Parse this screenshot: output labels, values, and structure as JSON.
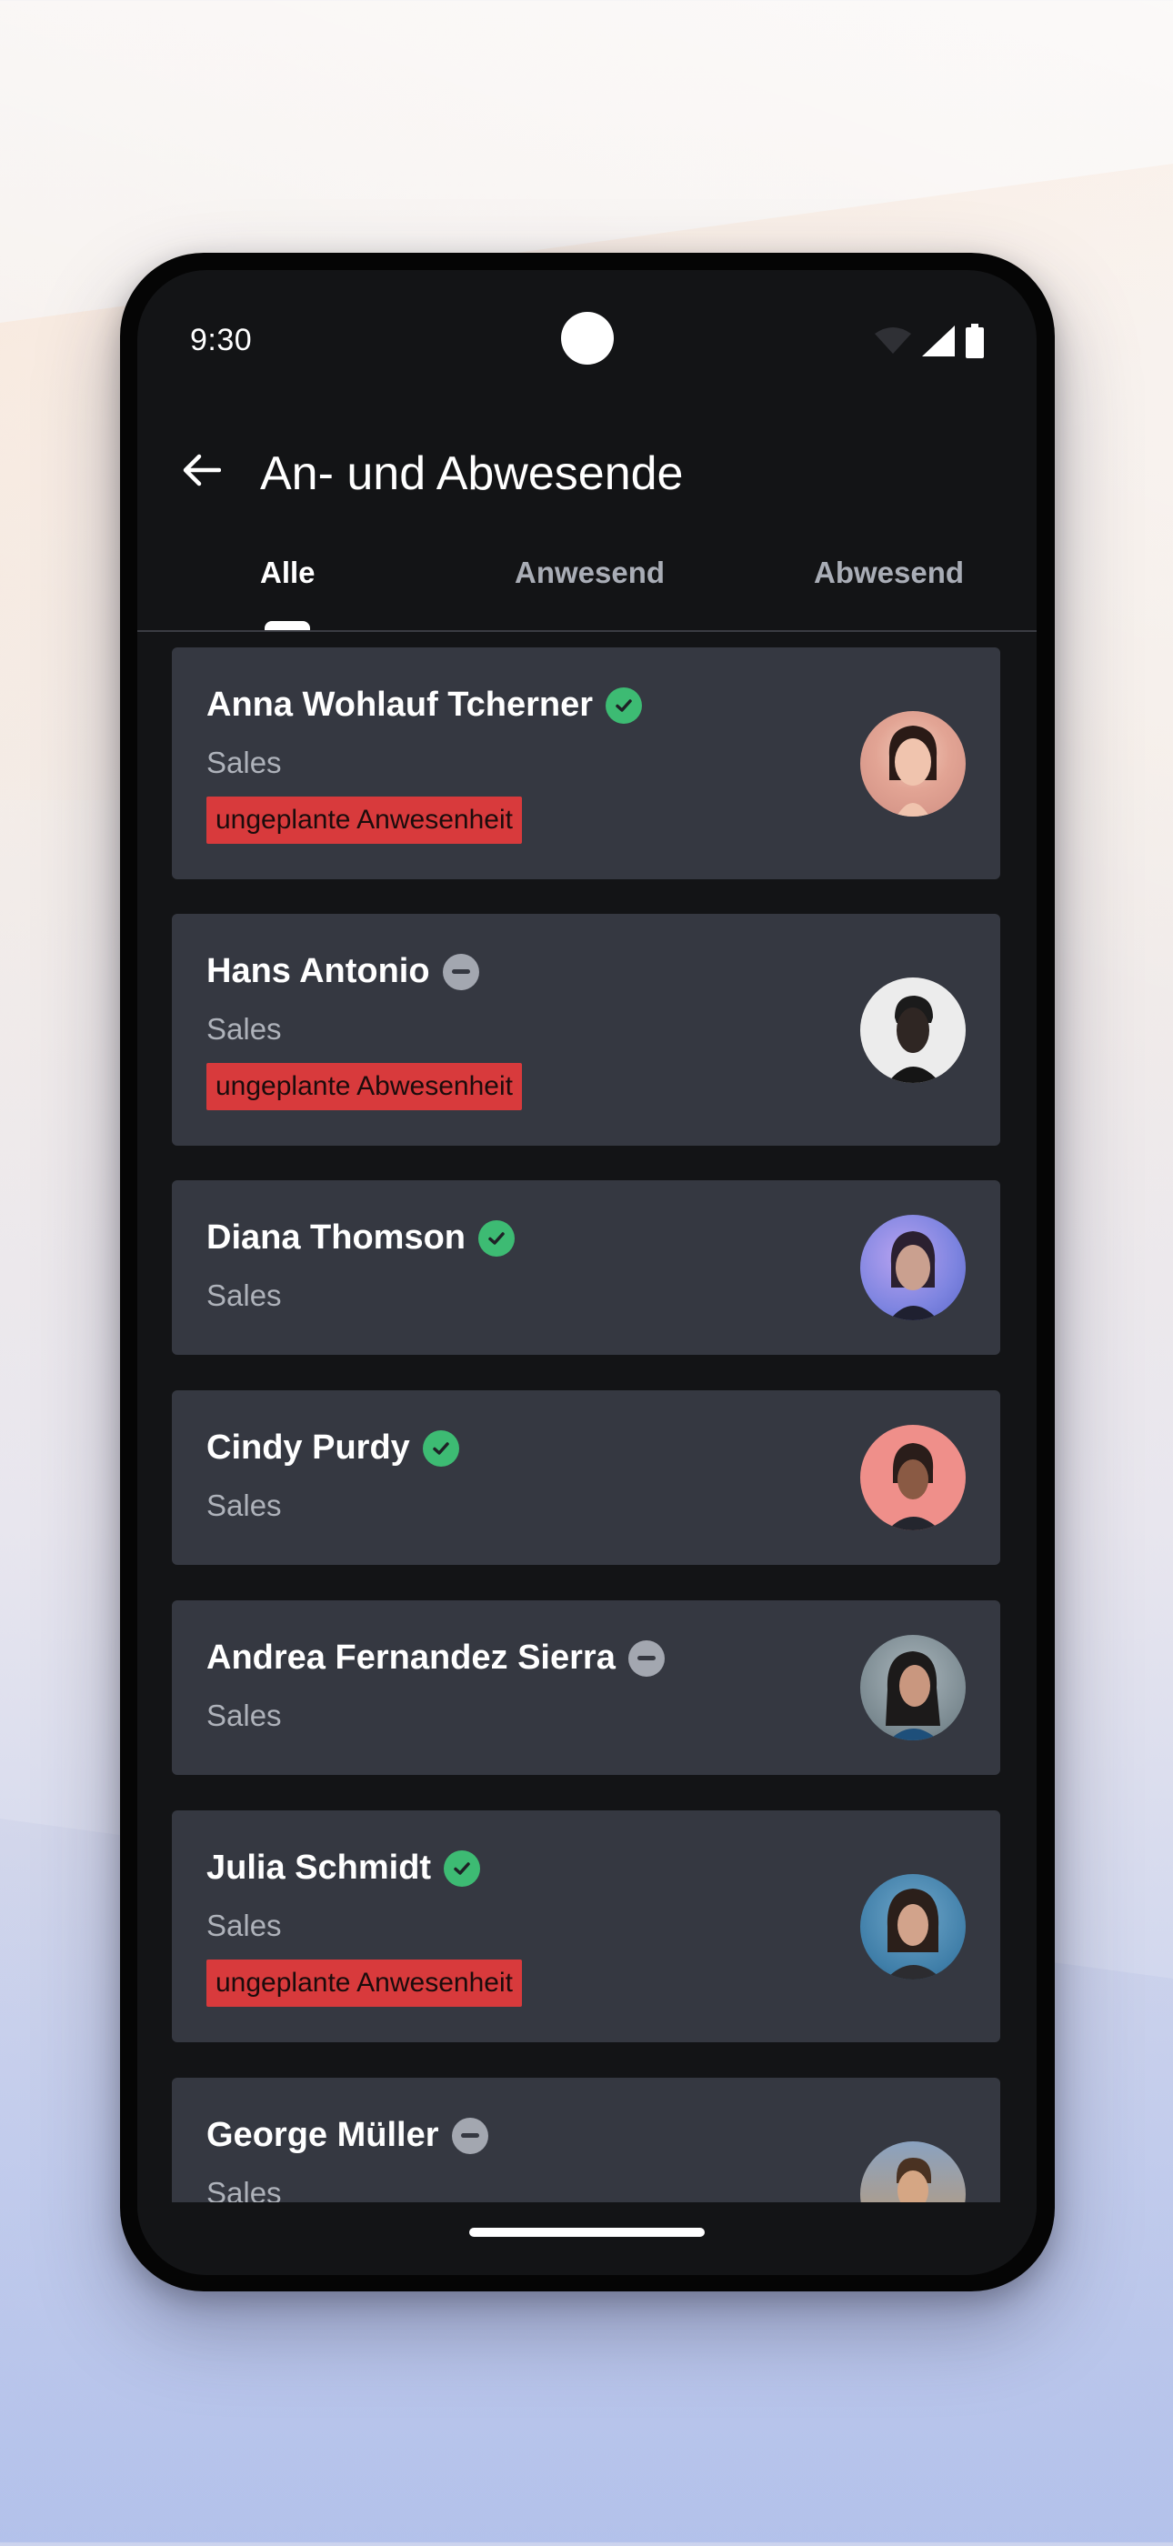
{
  "status_bar": {
    "time": "9:30"
  },
  "app_bar": {
    "title": "An- und Abwesende"
  },
  "tabs": [
    {
      "label": "Alle",
      "active": true
    },
    {
      "label": "Anwesend",
      "active": false
    },
    {
      "label": "Abwesend",
      "active": false
    }
  ],
  "employees": [
    {
      "name": "Anna Wohlauf Tcherner",
      "status": "present",
      "department": "Sales",
      "badge": "ungeplante Anwesenheit",
      "avatar_color": "#d9968c"
    },
    {
      "name": "Hans Antonio",
      "status": "absent",
      "department": "Sales",
      "badge": "ungeplante Abwesenheit",
      "avatar_color": "#e6e6e6"
    },
    {
      "name": "Diana Thomson",
      "status": "present",
      "department": "Sales",
      "badge": "",
      "avatar_color": "#8f93e6"
    },
    {
      "name": "Cindy Purdy",
      "status": "present",
      "department": "Sales",
      "badge": "",
      "avatar_color": "#ef8f8a"
    },
    {
      "name": "Andrea Fernandez Sierra",
      "status": "absent",
      "department": "Sales",
      "badge": "",
      "avatar_color": "#7d8c96"
    },
    {
      "name": "Julia Schmidt",
      "status": "present",
      "department": "Sales",
      "badge": "ungeplante Anwesenheit",
      "avatar_color": "#4c8cb5"
    },
    {
      "name": "George Müller",
      "status": "absent",
      "department": "Sales",
      "badge": "",
      "avatar_color": "#8a9bb3"
    }
  ],
  "colors": {
    "present": "#3dbb73",
    "absent": "#a3a7b0",
    "badge": "#d83a3c",
    "card": "#353841",
    "screen": "#131416"
  },
  "icons": {
    "back": "arrow-left-icon",
    "present": "check-circle-icon",
    "absent": "minus-circle-icon"
  }
}
